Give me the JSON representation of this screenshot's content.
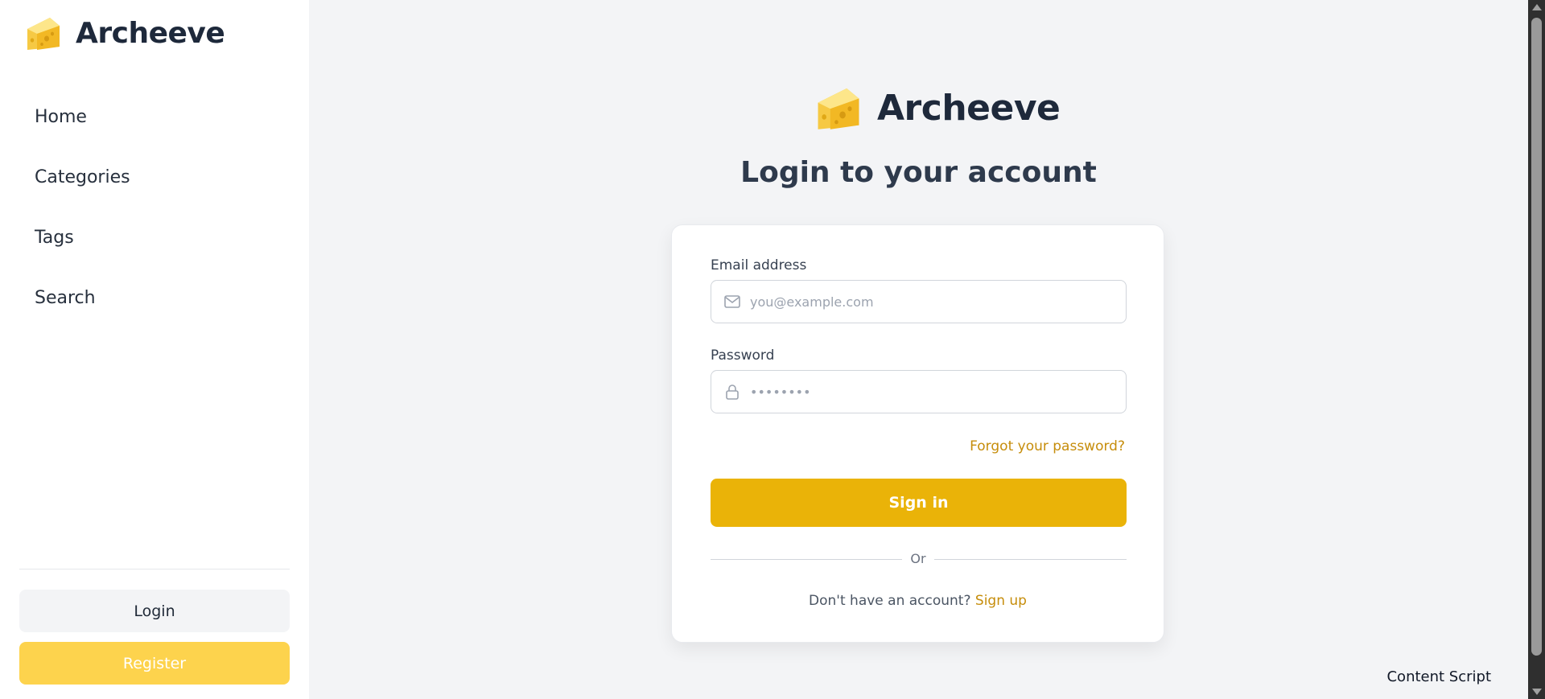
{
  "app": {
    "name": "Archeeve"
  },
  "sidebar": {
    "brand": "Archeeve",
    "nav": [
      {
        "label": "Home"
      },
      {
        "label": "Categories"
      },
      {
        "label": "Tags"
      },
      {
        "label": "Search"
      }
    ],
    "login_label": "Login",
    "register_label": "Register"
  },
  "main": {
    "logo_text": "Archeeve",
    "title": "Login to your account",
    "form": {
      "email_label": "Email address",
      "email_placeholder": "you@example.com",
      "email_value": "",
      "email_icon": "mail-icon",
      "password_label": "Password",
      "password_placeholder": "••••••••",
      "password_value": "",
      "password_icon": "lock-icon",
      "forgot_label": "Forgot your password?",
      "signin_label": "Sign in",
      "divider_label": "Or",
      "no_account_text": "Don't have an account?",
      "signup_label": "Sign up"
    }
  },
  "footer": {
    "content_script": "Content Script"
  },
  "colors": {
    "accent": "#eab308",
    "accent_light": "#fdd34d",
    "link": "#c68d0b",
    "background": "#f3f4f6"
  }
}
